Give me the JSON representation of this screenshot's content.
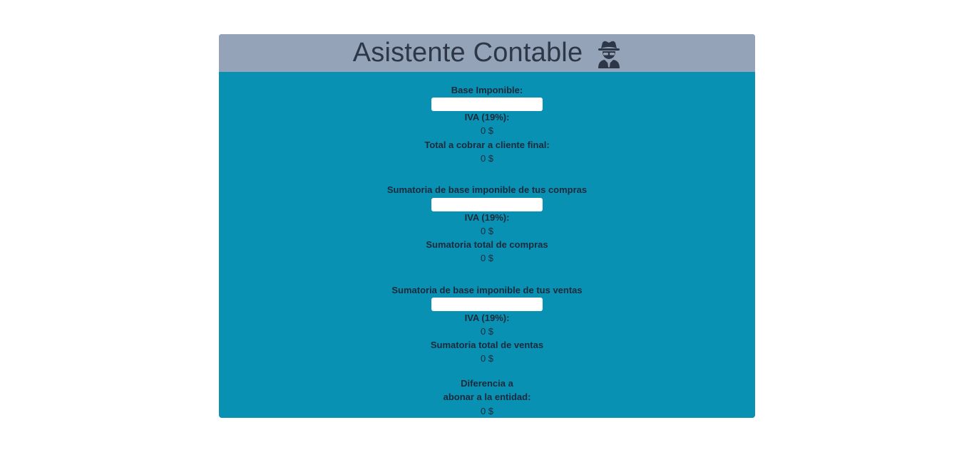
{
  "app": {
    "title": "Asistente Contable"
  },
  "section1": {
    "base_label": "Base Imponible:",
    "base_value": "",
    "iva_label": "IVA (19%):",
    "iva_value": "0 $",
    "total_label": "Total a cobrar a cliente final:",
    "total_value": "0 $"
  },
  "compras": {
    "base_label": "Sumatoria de base imponible de tus compras",
    "base_value": "",
    "iva_label": "IVA (19%):",
    "iva_value": "0 $",
    "total_label": "Sumatoria total de compras",
    "total_value": "0 $"
  },
  "ventas": {
    "base_label": "Sumatoria de base imponible de tus ventas",
    "base_value": "",
    "iva_label": "IVA (19%):",
    "iva_value": "0 $",
    "total_label": "Sumatoria total de ventas",
    "total_value": "0 $"
  },
  "diferencia": {
    "label_line1": "Diferencia a",
    "label_line2": "abonar a la entidad:",
    "value": "0 $"
  },
  "icons": {
    "header_icon": "user-secret-icon"
  },
  "colors": {
    "card_bg": "#0891b2",
    "header_bg": "#94a3b8",
    "text": "#1e293b"
  }
}
